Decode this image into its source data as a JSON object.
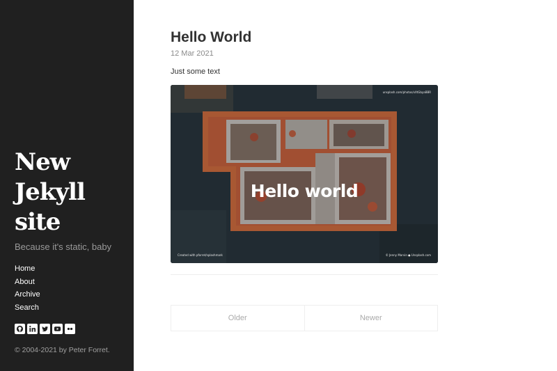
{
  "sidebar": {
    "site_title": "New Jekyll site",
    "tagline": "Because it's static, baby",
    "nav": [
      "Home",
      "About",
      "Archive",
      "Search"
    ],
    "social_icons": [
      "github-icon",
      "linkedin-icon",
      "twitter-icon",
      "youtube-icon",
      "flickr-icon"
    ],
    "copyright": "© 2004-2021 by Peter Forret."
  },
  "post": {
    "title": "Hello World",
    "date": "12 Mar 2021",
    "body": "Just some text",
    "image": {
      "overlay_text": "Hello world",
      "credit_top": "unsplash.com/photos/xXtGbyaBBR",
      "credit_left": "Created with pforret/splashmark",
      "credit_right": "© Jenny Marvin ● Unsplash.com"
    }
  },
  "pagination": {
    "older": "Older",
    "newer": "Newer"
  },
  "colors": {
    "sidebar_bg": "#202020",
    "text": "#313131",
    "muted": "#8a8a8a"
  }
}
